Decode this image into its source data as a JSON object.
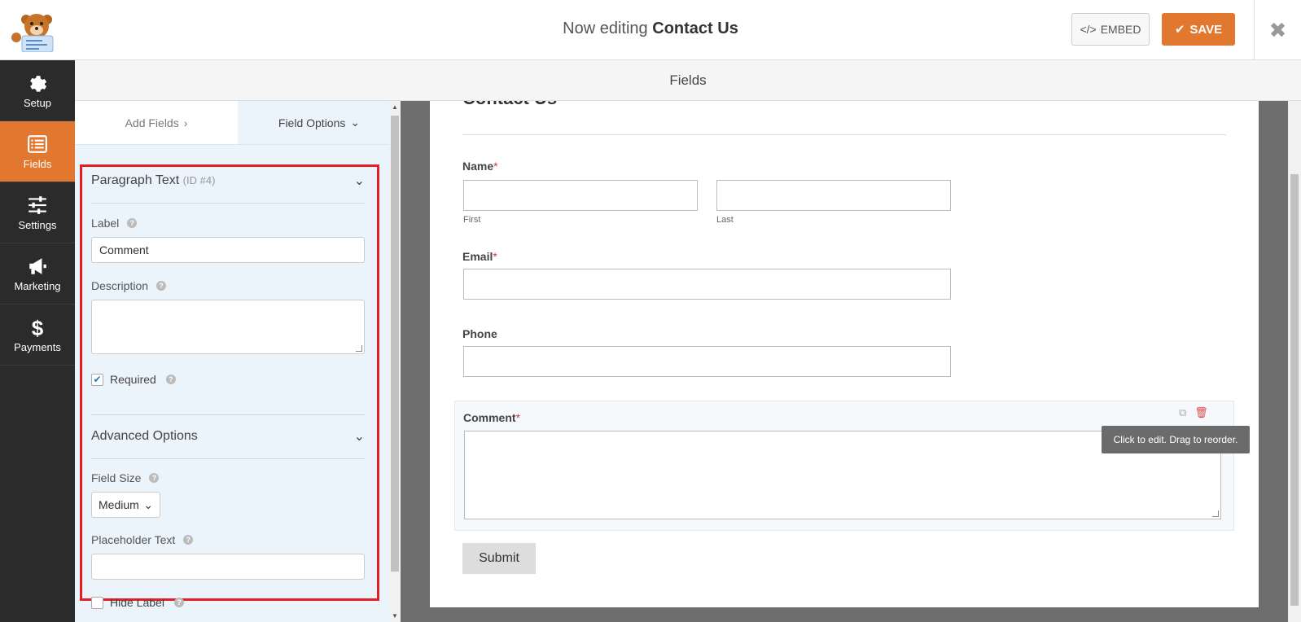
{
  "header": {
    "title_prefix": "Now editing",
    "title_form": "Contact Us",
    "embed_label": "EMBED",
    "save_label": "SAVE",
    "close_icon": "close-icon",
    "accent_color": "#e27730"
  },
  "leftnav": {
    "items": [
      {
        "label": "Setup",
        "icon": "gear-icon"
      },
      {
        "label": "Fields",
        "icon": "list-icon",
        "active": true
      },
      {
        "label": "Settings",
        "icon": "sliders-icon"
      },
      {
        "label": "Marketing",
        "icon": "megaphone-icon"
      },
      {
        "label": "Payments",
        "icon": "dollar-icon"
      }
    ]
  },
  "fields_header": "Fields",
  "panel": {
    "tabs": [
      {
        "label": "Add Fields",
        "icon": "chevron-right-icon"
      },
      {
        "label": "Field Options",
        "icon": "chevron-down-icon",
        "active": true
      }
    ],
    "field_type": "Paragraph Text",
    "field_id": "(ID #4)",
    "label_label": "Label",
    "label_value": "Comment",
    "description_label": "Description",
    "description_value": "",
    "required_label": "Required",
    "required_checked": true,
    "advanced_title": "Advanced Options",
    "field_size_label": "Field Size",
    "field_size_value": "Medium",
    "placeholder_label": "Placeholder Text",
    "placeholder_value": "",
    "hide_label": "Hide Label",
    "hide_label_checked": false
  },
  "form": {
    "title": "Contact Us",
    "name_label": "Name",
    "first_sublabel": "First",
    "last_sublabel": "Last",
    "email_label": "Email",
    "phone_label": "Phone",
    "comment_label": "Comment",
    "required_mark": "*",
    "tooltip": "Click to edit. Drag to reorder.",
    "submit_label": "Submit"
  }
}
